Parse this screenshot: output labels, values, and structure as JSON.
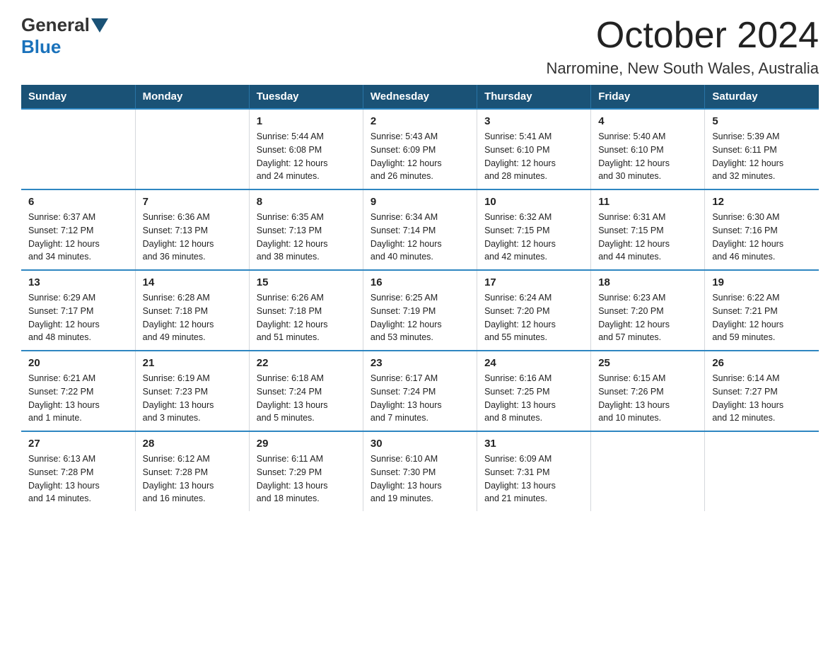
{
  "header": {
    "logo": {
      "general": "General",
      "blue": "Blue"
    },
    "title": "October 2024",
    "location": "Narromine, New South Wales, Australia"
  },
  "calendar": {
    "weekdays": [
      "Sunday",
      "Monday",
      "Tuesday",
      "Wednesday",
      "Thursday",
      "Friday",
      "Saturday"
    ],
    "weeks": [
      [
        {
          "day": "",
          "info": ""
        },
        {
          "day": "",
          "info": ""
        },
        {
          "day": "1",
          "info": "Sunrise: 5:44 AM\nSunset: 6:08 PM\nDaylight: 12 hours\nand 24 minutes."
        },
        {
          "day": "2",
          "info": "Sunrise: 5:43 AM\nSunset: 6:09 PM\nDaylight: 12 hours\nand 26 minutes."
        },
        {
          "day": "3",
          "info": "Sunrise: 5:41 AM\nSunset: 6:10 PM\nDaylight: 12 hours\nand 28 minutes."
        },
        {
          "day": "4",
          "info": "Sunrise: 5:40 AM\nSunset: 6:10 PM\nDaylight: 12 hours\nand 30 minutes."
        },
        {
          "day": "5",
          "info": "Sunrise: 5:39 AM\nSunset: 6:11 PM\nDaylight: 12 hours\nand 32 minutes."
        }
      ],
      [
        {
          "day": "6",
          "info": "Sunrise: 6:37 AM\nSunset: 7:12 PM\nDaylight: 12 hours\nand 34 minutes."
        },
        {
          "day": "7",
          "info": "Sunrise: 6:36 AM\nSunset: 7:13 PM\nDaylight: 12 hours\nand 36 minutes."
        },
        {
          "day": "8",
          "info": "Sunrise: 6:35 AM\nSunset: 7:13 PM\nDaylight: 12 hours\nand 38 minutes."
        },
        {
          "day": "9",
          "info": "Sunrise: 6:34 AM\nSunset: 7:14 PM\nDaylight: 12 hours\nand 40 minutes."
        },
        {
          "day": "10",
          "info": "Sunrise: 6:32 AM\nSunset: 7:15 PM\nDaylight: 12 hours\nand 42 minutes."
        },
        {
          "day": "11",
          "info": "Sunrise: 6:31 AM\nSunset: 7:15 PM\nDaylight: 12 hours\nand 44 minutes."
        },
        {
          "day": "12",
          "info": "Sunrise: 6:30 AM\nSunset: 7:16 PM\nDaylight: 12 hours\nand 46 minutes."
        }
      ],
      [
        {
          "day": "13",
          "info": "Sunrise: 6:29 AM\nSunset: 7:17 PM\nDaylight: 12 hours\nand 48 minutes."
        },
        {
          "day": "14",
          "info": "Sunrise: 6:28 AM\nSunset: 7:18 PM\nDaylight: 12 hours\nand 49 minutes."
        },
        {
          "day": "15",
          "info": "Sunrise: 6:26 AM\nSunset: 7:18 PM\nDaylight: 12 hours\nand 51 minutes."
        },
        {
          "day": "16",
          "info": "Sunrise: 6:25 AM\nSunset: 7:19 PM\nDaylight: 12 hours\nand 53 minutes."
        },
        {
          "day": "17",
          "info": "Sunrise: 6:24 AM\nSunset: 7:20 PM\nDaylight: 12 hours\nand 55 minutes."
        },
        {
          "day": "18",
          "info": "Sunrise: 6:23 AM\nSunset: 7:20 PM\nDaylight: 12 hours\nand 57 minutes."
        },
        {
          "day": "19",
          "info": "Sunrise: 6:22 AM\nSunset: 7:21 PM\nDaylight: 12 hours\nand 59 minutes."
        }
      ],
      [
        {
          "day": "20",
          "info": "Sunrise: 6:21 AM\nSunset: 7:22 PM\nDaylight: 13 hours\nand 1 minute."
        },
        {
          "day": "21",
          "info": "Sunrise: 6:19 AM\nSunset: 7:23 PM\nDaylight: 13 hours\nand 3 minutes."
        },
        {
          "day": "22",
          "info": "Sunrise: 6:18 AM\nSunset: 7:24 PM\nDaylight: 13 hours\nand 5 minutes."
        },
        {
          "day": "23",
          "info": "Sunrise: 6:17 AM\nSunset: 7:24 PM\nDaylight: 13 hours\nand 7 minutes."
        },
        {
          "day": "24",
          "info": "Sunrise: 6:16 AM\nSunset: 7:25 PM\nDaylight: 13 hours\nand 8 minutes."
        },
        {
          "day": "25",
          "info": "Sunrise: 6:15 AM\nSunset: 7:26 PM\nDaylight: 13 hours\nand 10 minutes."
        },
        {
          "day": "26",
          "info": "Sunrise: 6:14 AM\nSunset: 7:27 PM\nDaylight: 13 hours\nand 12 minutes."
        }
      ],
      [
        {
          "day": "27",
          "info": "Sunrise: 6:13 AM\nSunset: 7:28 PM\nDaylight: 13 hours\nand 14 minutes."
        },
        {
          "day": "28",
          "info": "Sunrise: 6:12 AM\nSunset: 7:28 PM\nDaylight: 13 hours\nand 16 minutes."
        },
        {
          "day": "29",
          "info": "Sunrise: 6:11 AM\nSunset: 7:29 PM\nDaylight: 13 hours\nand 18 minutes."
        },
        {
          "day": "30",
          "info": "Sunrise: 6:10 AM\nSunset: 7:30 PM\nDaylight: 13 hours\nand 19 minutes."
        },
        {
          "day": "31",
          "info": "Sunrise: 6:09 AM\nSunset: 7:31 PM\nDaylight: 13 hours\nand 21 minutes."
        },
        {
          "day": "",
          "info": ""
        },
        {
          "day": "",
          "info": ""
        }
      ]
    ]
  }
}
